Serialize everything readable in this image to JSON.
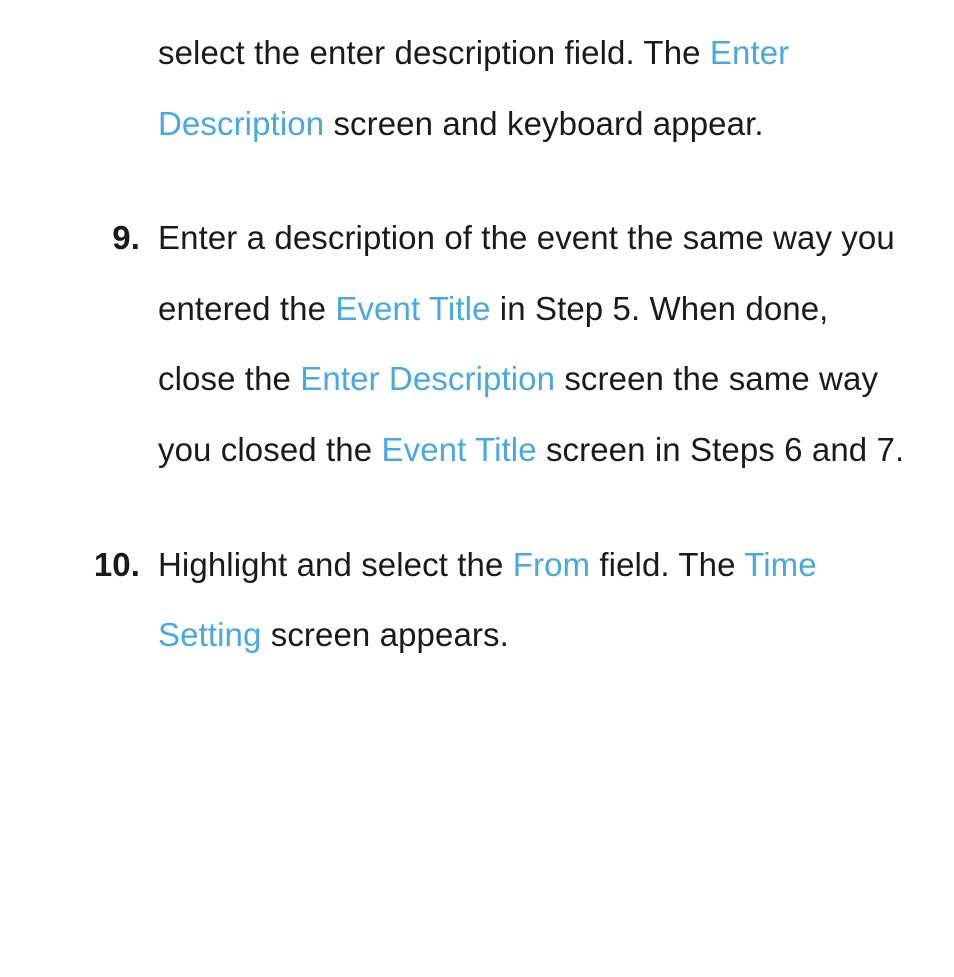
{
  "link_color": "#4aa8e0",
  "steps": [
    {
      "number": "",
      "segments": [
        {
          "t": "select the enter description field. The "
        },
        {
          "t": "Enter Description",
          "hl": true
        },
        {
          "t": " screen and keyboard appear."
        }
      ]
    },
    {
      "number": "9.",
      "segments": [
        {
          "t": "Enter a description of the event the same way you entered the "
        },
        {
          "t": "Event Title",
          "hl": true
        },
        {
          "t": " in Step 5. When done, close the "
        },
        {
          "t": "Enter Description",
          "hl": true
        },
        {
          "t": " screen the same way you closed the "
        },
        {
          "t": "Event Title",
          "hl": true
        },
        {
          "t": " screen in Steps 6 and 7."
        }
      ]
    },
    {
      "number": "10.",
      "segments": [
        {
          "t": "Highlight and select the "
        },
        {
          "t": "From",
          "hl": true
        },
        {
          "t": " field. The "
        },
        {
          "t": "Time Setting",
          "hl": true
        },
        {
          "t": " screen appears."
        }
      ]
    }
  ]
}
